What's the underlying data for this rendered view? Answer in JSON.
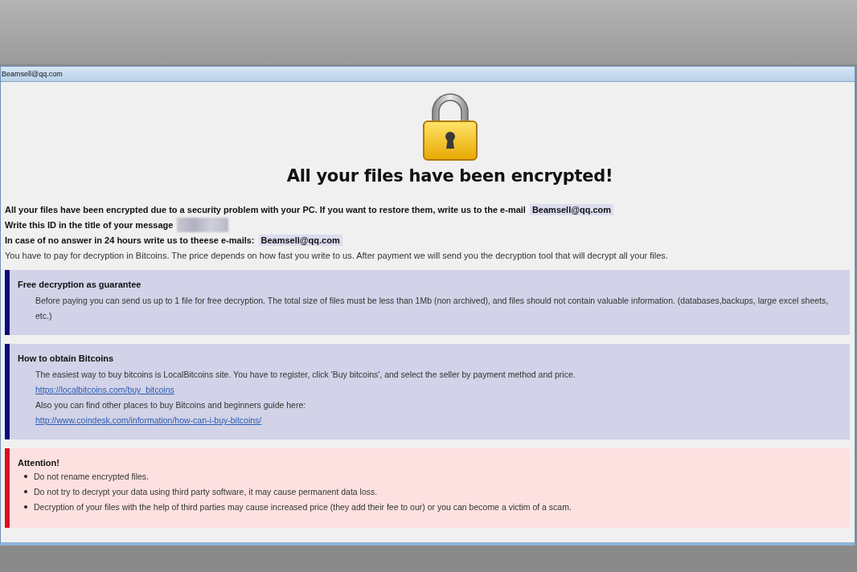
{
  "window": {
    "title": "Beamsell@qq.com"
  },
  "heading": "All your files have been encrypted!",
  "intro": [
    {
      "text": "All your files have been encrypted due to a security problem with your PC. If you want to restore them, write us to the e-mail",
      "bold": true,
      "email": "Beamsell@qq.com",
      "id_redacted": false
    },
    {
      "text": "Write this ID in the title of your message",
      "bold": true,
      "id_redacted": true
    },
    {
      "text": "In case of no answer in 24 hours write us to theese e-mails:",
      "bold": true,
      "email": "Beamsell@qq.com",
      "id_redacted": false
    },
    {
      "text": "You have to pay for decryption in Bitcoins. The price depends on how fast you write to us. After payment we will send you the decryption tool that will decrypt all your files.",
      "bold": false,
      "id_redacted": false
    }
  ],
  "sections": [
    {
      "kind": "info",
      "title": "Free decryption as guarantee",
      "items": [
        {
          "kind": "text",
          "text": "Before paying you can send us up to 1 file for free decryption. The total size of files must be less than 1Mb (non archived), and files should not contain valuable information. (databases,backups, large excel sheets, etc.)"
        }
      ]
    },
    {
      "kind": "info",
      "title": "How to obtain Bitcoins",
      "items": [
        {
          "kind": "text",
          "text": "The easiest way to buy bitcoins is LocalBitcoins site. You have to register, click 'Buy bitcoins', and select the seller by payment method and price."
        },
        {
          "kind": "link",
          "text": "https://localbitcoins.com/buy_bitcoins"
        },
        {
          "kind": "text",
          "text": "Also you can find other places to buy Bitcoins and beginners guide here:"
        },
        {
          "kind": "link",
          "text": "http://www.coindesk.com/information/how-can-i-buy-bitcoins/"
        }
      ]
    },
    {
      "kind": "warning",
      "title": "Attention!",
      "items": [
        {
          "kind": "bullet",
          "text": "Do not rename encrypted files."
        },
        {
          "kind": "bullet",
          "text": "Do not try to decrypt your data using third party software, it may cause permanent data loss."
        },
        {
          "kind": "bullet",
          "text": "Decryption of your files with the help of third parties may cause increased price (they add their fee to our) or you can become a victim of a scam."
        }
      ]
    }
  ]
}
